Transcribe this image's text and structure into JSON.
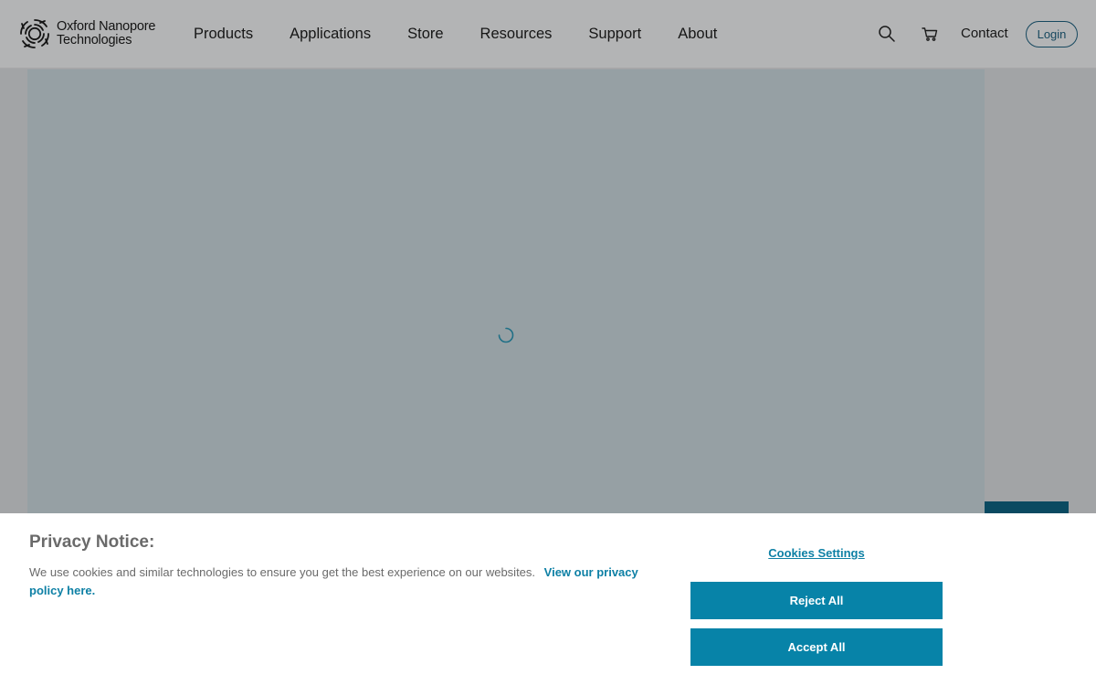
{
  "header": {
    "logo": {
      "line1": "Oxford Nanopore",
      "line2": "Technologies"
    },
    "nav": [
      "Products",
      "Applications",
      "Store",
      "Resources",
      "Support",
      "About"
    ],
    "tools": {
      "search_icon": "search-icon",
      "cart_icon": "cart-icon",
      "contact": "Contact",
      "login": "Login"
    }
  },
  "hero": {
    "state": "loading",
    "spinner_icon": "loading-spinner-icon"
  },
  "cookie": {
    "title": "Privacy Notice:",
    "text": "We use cookies and similar technologies to ensure you get the best experience on our websites.",
    "link": "View our privacy policy here.",
    "settings": "Cookies Settings",
    "reject": "Reject All",
    "accept": "Accept All"
  },
  "colors": {
    "accent": "#0783a8",
    "link": "#0e80a5",
    "login_border": "#17485f",
    "side_block": "#0a4a61"
  }
}
